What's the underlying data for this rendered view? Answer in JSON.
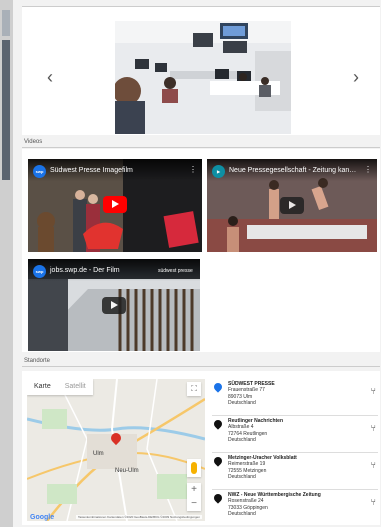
{
  "gallery": {
    "prev_arrow": "‹",
    "next_arrow": "›"
  },
  "sections": {
    "videos_label": "Videos",
    "locations_label": "Standorte"
  },
  "videos": [
    {
      "title": "Südwest Presse Imagefilm",
      "logo": "swp",
      "play_color": "#ff0000"
    },
    {
      "title": "Neue Pressegesellschaft - Zeitung kan…",
      "logo": "▶",
      "play_color": "#212121"
    },
    {
      "title": "jobs.swp.de - Der Film",
      "logo": "swp",
      "play_color": "#212121",
      "watermark": "südwest presse"
    }
  ],
  "map": {
    "tab_map": "Karte",
    "tab_satellite": "Satellit",
    "fullscreen_icon": "⛶",
    "zoom_in": "+",
    "zoom_out": "−",
    "google": "Google",
    "legal": "Tastenkombinationen  Kartendaten ©2020 GeoBasis-DE/BKG ©2009  Nutzungsbedingungen",
    "cities": [
      "Ulm",
      "Neu-Ulm"
    ]
  },
  "locations": [
    {
      "name": "SÜDWEST PRESSE",
      "street": "Frauenstraße 77",
      "city": "89073 Ulm",
      "country": "Deutschland",
      "pin": "blue"
    },
    {
      "name": "Reutlinger Nachrichten",
      "street": "Albstraße 4",
      "city": "72764 Reutlingen",
      "country": "Deutschland",
      "pin": "black"
    },
    {
      "name": "Metzinger-Uracher Volksblatt",
      "street": "Reimerstraße 19",
      "city": "72555 Metzingen",
      "country": "Deutschland",
      "pin": "black"
    },
    {
      "name": "NWZ - Neue Württembergische Zeitung",
      "street": "Rosenstraße 24",
      "city": "73033 Göppingen",
      "country": "Deutschland",
      "pin": "black"
    }
  ],
  "colors": {
    "accent": "#1a73e8",
    "marker": "#d93025",
    "youtube_red": "#ff0000"
  }
}
